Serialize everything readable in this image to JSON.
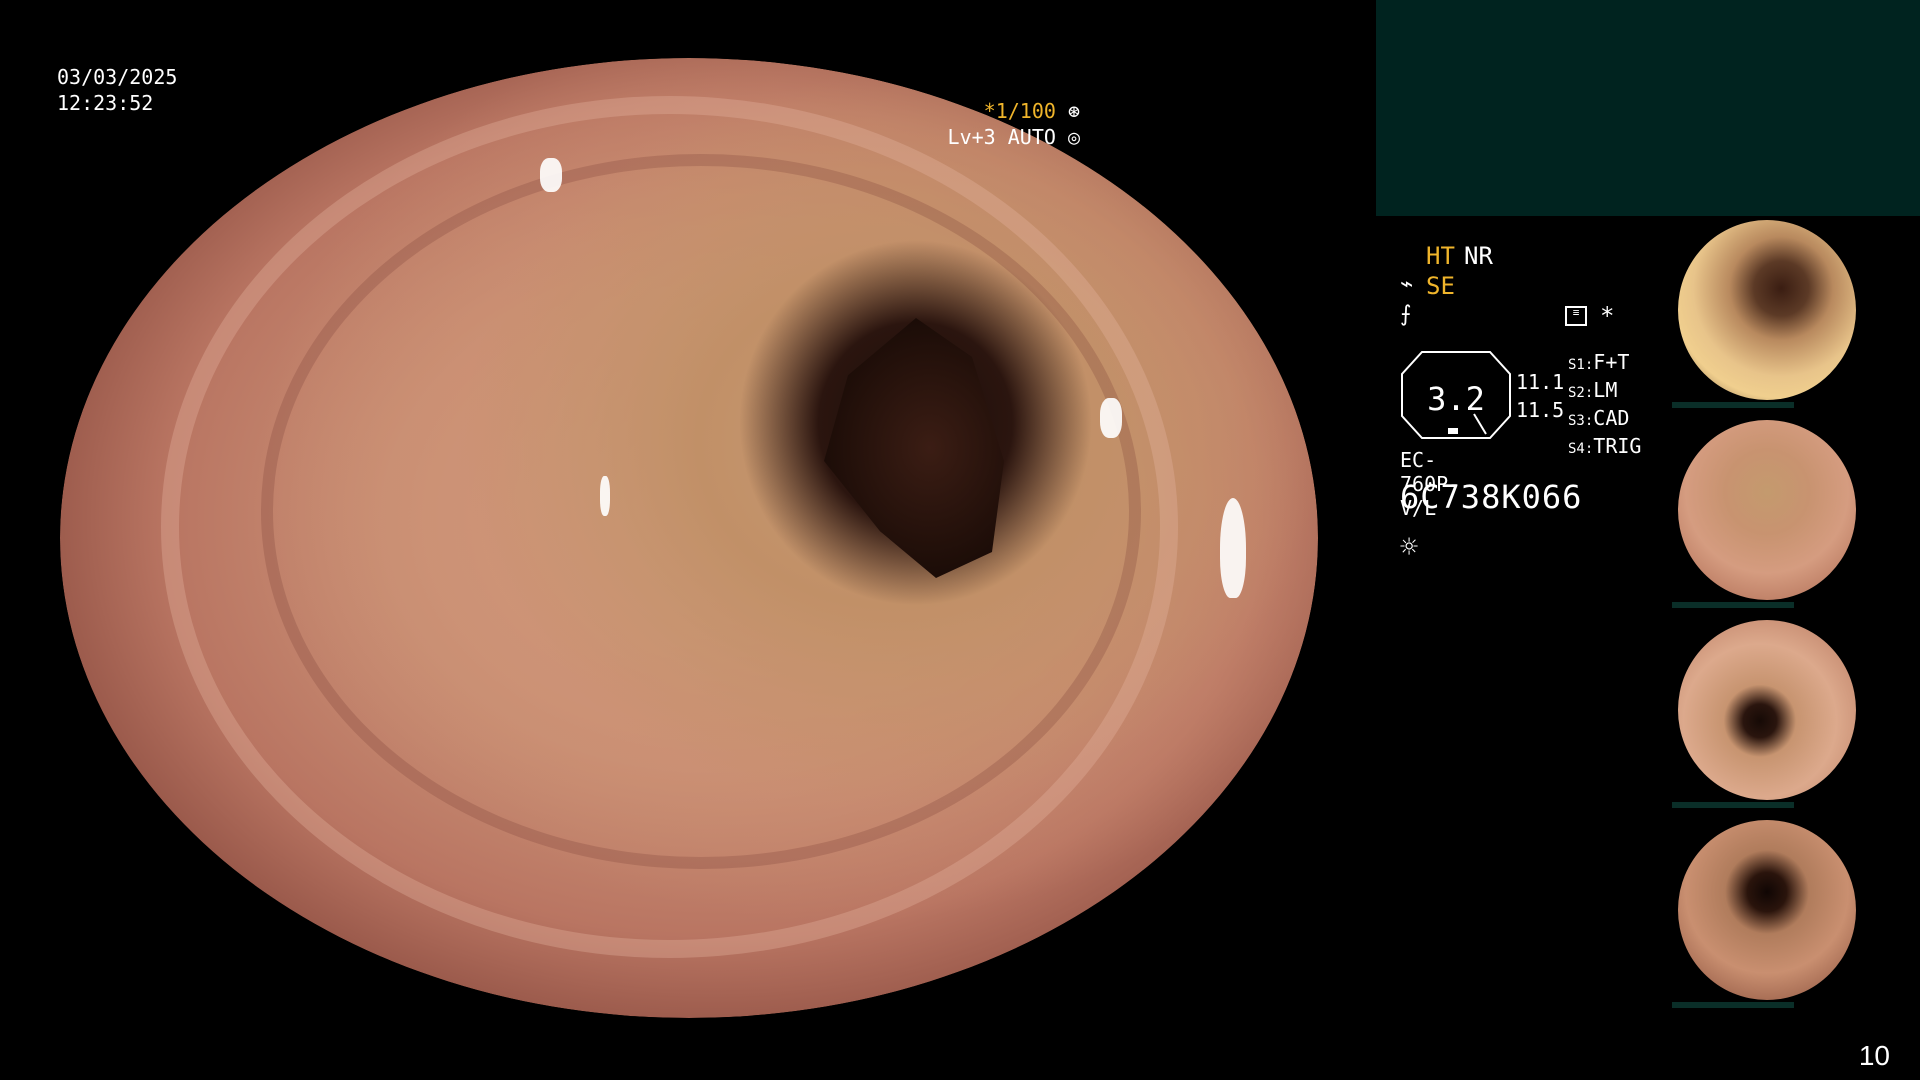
{
  "scope": {
    "date": "03/03/2025",
    "time": "12:23:52",
    "shutter": "*1/100",
    "light_level": "Lv+3 AUTO"
  },
  "panel": {
    "ht": "HT",
    "nr": "NR",
    "se": "SE",
    "star": "*",
    "gauge_value": "3.2",
    "num1": "11.1",
    "num2": "11.5",
    "s1_key": "S1:",
    "s1_val": "F+T",
    "s2_key": "S2:",
    "s2_val": "LM",
    "s3_key": "S3:",
    "s3_val": "CAD",
    "s4_key": "S4:",
    "s4_val": "TRIG",
    "model": "EC-760P-V/L",
    "serial": "6C738K066",
    "icons": {
      "se": "scope-icon",
      "f": "filter-icon",
      "box": "memory-icon",
      "sun": "brightness-icon"
    }
  },
  "thumbnails": [
    {
      "label": "thumbnail-1",
      "tone": "#e2b98a"
    },
    {
      "label": "thumbnail-2",
      "tone": "#c68a6a"
    },
    {
      "label": "thumbnail-3",
      "tone": "#d69a7a"
    },
    {
      "label": "thumbnail-4",
      "tone": "#b87f63"
    }
  ],
  "page_number": "10",
  "colors": {
    "accent": "#f0b52b",
    "panel_teal": "#00231f"
  }
}
